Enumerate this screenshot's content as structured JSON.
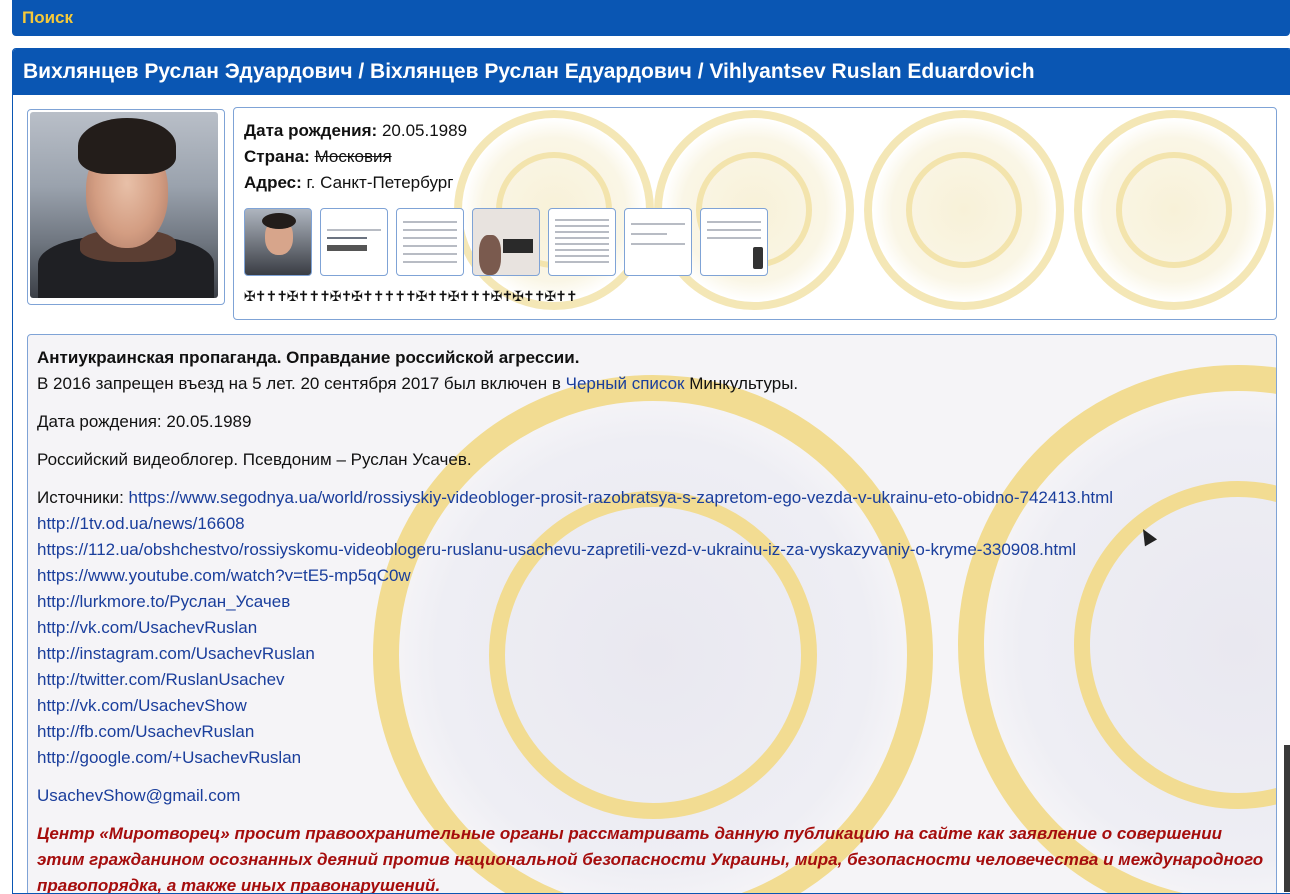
{
  "search_bar": {
    "label": "Поиск"
  },
  "profile": {
    "title": "Вихлянцев Руслан Эдуардович / Віхлянцев Руслан Едуардович / Vihlyantsev Ruslan Eduardovich",
    "birth_label": "Дата рождения:",
    "birth_value": "20.05.1989",
    "country_label": "Страна:",
    "country_value": "Московия",
    "address_label": "Адрес:",
    "address_value": "г. Санкт-Петербург",
    "crosses": "✠✝✝✝✠✝✝✝✠✝✠✝✝✝✝✝✠✝✝✠✝✝✝✠✝✠✝✝✠✝✝"
  },
  "content": {
    "heading": "Антиукраинская пропаганда. Оправдание российской агрессии.",
    "ban_prefix": "В 2016 запрещен въезд на 5 лет. 20 сентября 2017 был включен в ",
    "ban_link": "Черный список",
    "ban_suffix": " Минкультуры.",
    "birth": "Дата рождения: 20.05.1989",
    "description": "Российский видеоблогер. Псевдоним – Руслан Усачев.",
    "sources_label": "Источники: ",
    "sources": [
      "https://www.segodnya.ua/world/rossiyskiy-videobloger-prosit-razobratsya-s-zapretom-ego-vezda-v-ukrainu-eto-obidno-742413.html",
      "http://1tv.od.ua/news/16608",
      "https://112.ua/obshchestvo/rossiyskomu-videoblogeru-ruslanu-usachevu-zapretili-vezd-v-ukrainu-iz-za-vyskazyvaniy-o-kryme-330908.html",
      "https://www.youtube.com/watch?v=tE5-mp5qC0w",
      "http://lurkmore.to/Руслан_Усачев",
      "http://vk.com/UsachevRuslan",
      "http://instagram.com/UsachevRuslan",
      "http://twitter.com/RuslanUsachev",
      "http://vk.com/UsachevShow",
      "http://fb.com/UsachevRuslan",
      "http://google.com/+UsachevRuslan"
    ],
    "email": "UsachevShow@gmail.com",
    "warning": "Центр «Миротворец» просит правоохранительные органы рассматривать данную публикацию на сайте как заявление о совершении этим гражданином осознанных деяний против национальной безопасности Украины, мира, безопасности человечества и международного правопорядка, а также иных правонарушений."
  }
}
